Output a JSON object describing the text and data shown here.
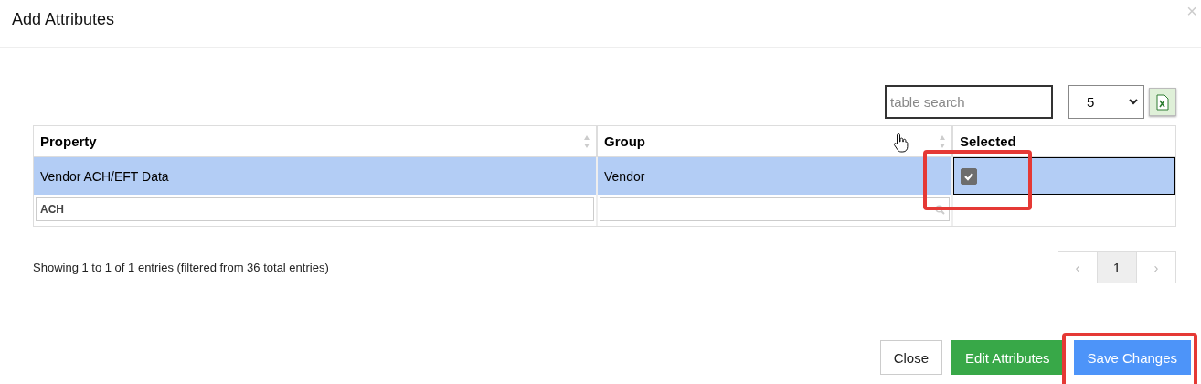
{
  "dialog": {
    "title": "Add Attributes",
    "close_glyph": "×"
  },
  "toolbar": {
    "search": {
      "placeholder": "table search"
    },
    "page_size": "5"
  },
  "table": {
    "columns": [
      {
        "label": "Property",
        "sortable": true
      },
      {
        "label": "Group",
        "sortable": true
      },
      {
        "label": "Selected",
        "sortable": false
      }
    ],
    "rows": [
      {
        "property": "Vendor ACH/EFT Data",
        "group": "Vendor",
        "checked": true,
        "selected": true
      }
    ],
    "filters": [
      {
        "kind": "plain",
        "value": "ACH"
      },
      {
        "kind": "search"
      }
    ]
  },
  "info": "Showing 1 to 1 of 1 entries (filtered from 36 total entries)",
  "pagination": {
    "prev": "‹",
    "pages": [
      {
        "label": "1",
        "selected": true
      }
    ],
    "next": "›"
  },
  "buttons": [
    {
      "label": "Close",
      "kind": "default"
    },
    {
      "label": "Edit Attributes",
      "kind": "success"
    },
    {
      "label": "Save Changes",
      "kind": "primary"
    }
  ]
}
